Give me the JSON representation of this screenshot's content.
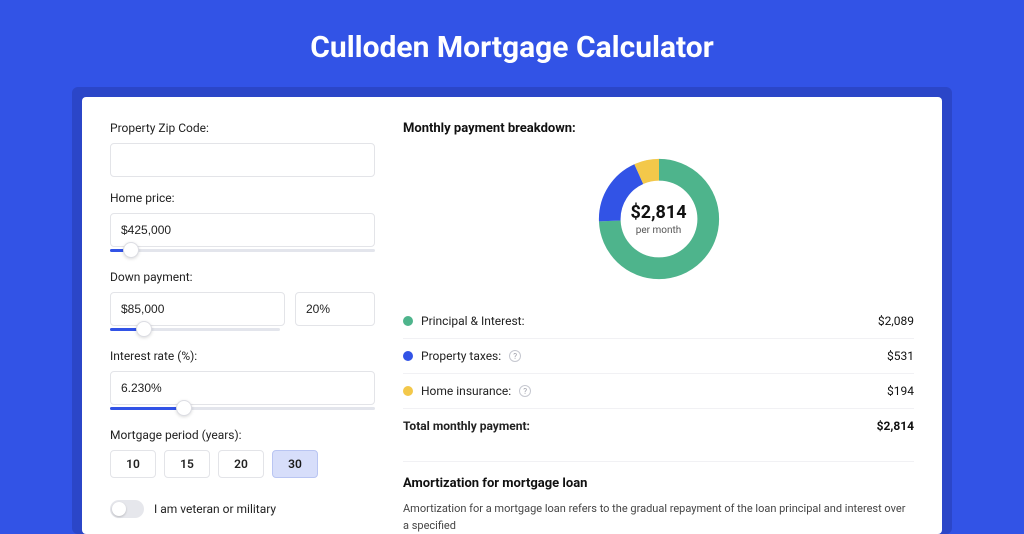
{
  "title": "Culloden Mortgage Calculator",
  "form": {
    "zip_label": "Property Zip Code:",
    "zip_value": "",
    "home_price_label": "Home price:",
    "home_price_value": "$425,000",
    "home_price_slider_pct": 8,
    "down_payment_label": "Down payment:",
    "down_payment_amount": "$85,000",
    "down_payment_pct_value": "20%",
    "down_payment_slider_pct": 20,
    "interest_label": "Interest rate (%):",
    "interest_value": "6.230%",
    "interest_slider_pct": 28,
    "period_label": "Mortgage period (years):",
    "periods": [
      "10",
      "15",
      "20",
      "30"
    ],
    "period_selected": "30",
    "veteran_label": "I am veteran or military",
    "veteran_on": false
  },
  "breakdown": {
    "heading": "Monthly payment breakdown:",
    "donut_amount": "$2,814",
    "donut_sub": "per month",
    "items": [
      {
        "label": "Principal & Interest:",
        "value": "$2,089",
        "color": "#4eb48c",
        "info": false
      },
      {
        "label": "Property taxes:",
        "value": "$531",
        "color": "#3253e6",
        "info": true
      },
      {
        "label": "Home insurance:",
        "value": "$194",
        "color": "#f3c84a",
        "info": true
      }
    ],
    "total_label": "Total monthly payment:",
    "total_value": "$2,814"
  },
  "amortization": {
    "title": "Amortization for mortgage loan",
    "text": "Amortization for a mortgage loan refers to the gradual repayment of the loan principal and interest over a specified"
  },
  "chart_data": {
    "type": "pie",
    "title": "Monthly payment breakdown",
    "series": [
      {
        "name": "Principal & Interest",
        "value": 2089,
        "color": "#4eb48c"
      },
      {
        "name": "Property taxes",
        "value": 531,
        "color": "#3253e6"
      },
      {
        "name": "Home insurance",
        "value": 194,
        "color": "#f3c84a"
      }
    ],
    "total": 2814,
    "center_label": "$2,814 per month"
  }
}
